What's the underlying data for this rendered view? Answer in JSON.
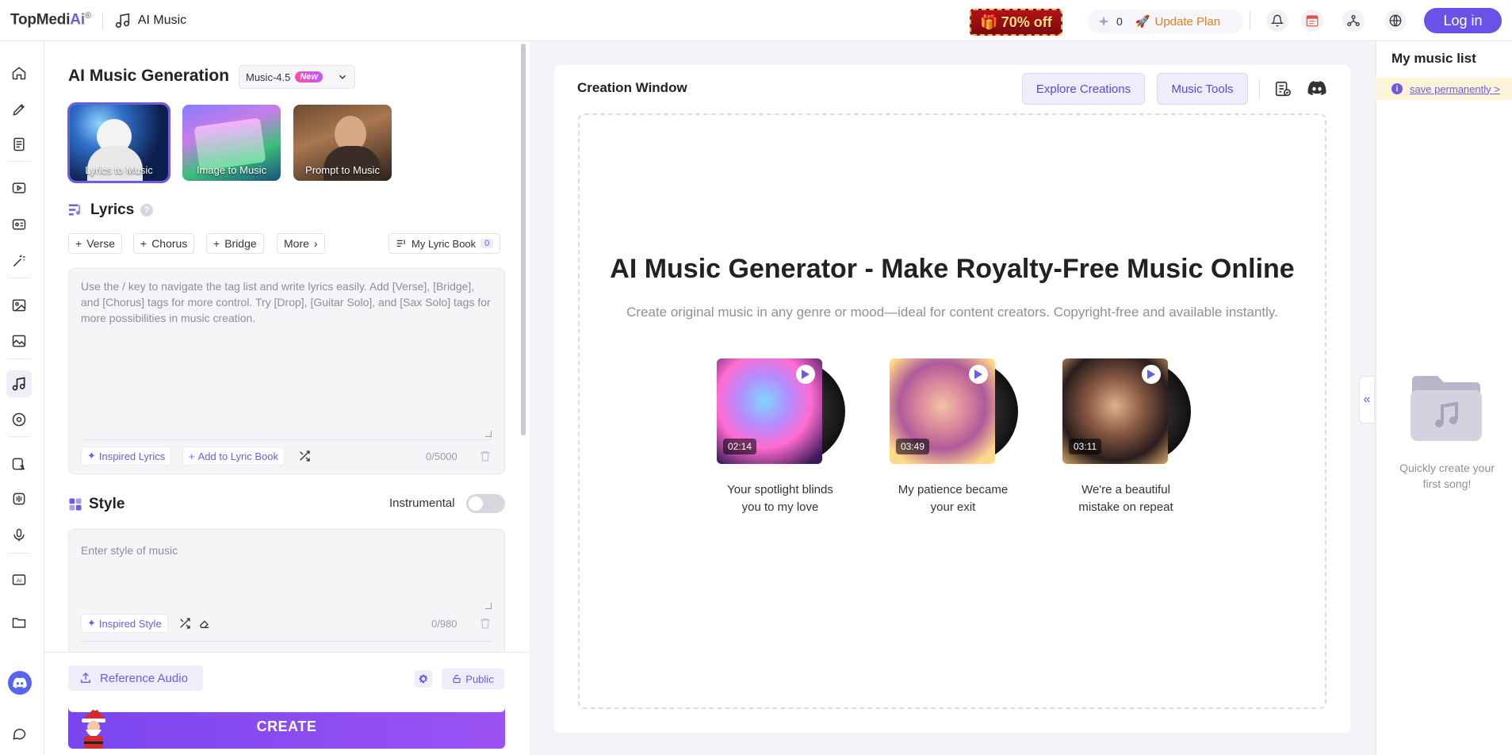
{
  "header": {
    "logo_main": "TopMedi",
    "logo_ai": "Ai",
    "logo_reg": "®",
    "app_name": "AI Music",
    "promo": "70% off",
    "credits": "0",
    "update_plan": "Update Plan",
    "login": "Log in"
  },
  "panel": {
    "title": "AI Music Generation",
    "model": "Music-4.5",
    "model_badge": "New",
    "modes": [
      {
        "label": "Lyrics to Music",
        "active": true
      },
      {
        "label": "Image to Music",
        "active": false
      },
      {
        "label": "Prompt to Music",
        "active": false
      }
    ],
    "lyrics": {
      "title": "Lyrics",
      "chips": [
        "Verse",
        "Chorus",
        "Bridge",
        "More"
      ],
      "lyric_book": "My Lyric Book",
      "lyric_book_count": "0",
      "placeholder": "Use the / key to navigate the tag list and write lyrics easily. Add [Verse], [Bridge], and [Chorus] tags for more control. Try [Drop], [Guitar Solo], and [Sax Solo] tags for more possibilities in music creation.",
      "inspired": "Inspired Lyrics",
      "add_book": "Add to Lyric Book",
      "counter": "0/5000"
    },
    "style": {
      "title": "Style",
      "instrumental": "Instrumental",
      "instrumental_on": false,
      "placeholder": "Enter style of music",
      "inspired": "Inspired Style",
      "counter": "0/980"
    },
    "reference_audio": "Reference Audio",
    "public": "Public",
    "create": "CREATE"
  },
  "creation": {
    "title": "Creation Window",
    "explore": "Explore Creations",
    "tools": "Music Tools",
    "headline": "AI Music Generator - Make Royalty-Free Music Online",
    "subline": "Create original music in any genre or mood—ideal for content creators. Copyright-free and available instantly.",
    "songs": [
      {
        "duration": "02:14",
        "title_l1": "Your spotlight blinds",
        "title_l2": "you to my love"
      },
      {
        "duration": "03:49",
        "title_l1": "My patience became",
        "title_l2": "your exit"
      },
      {
        "duration": "03:11",
        "title_l1": "We're a beautiful",
        "title_l2": "mistake on repeat"
      }
    ]
  },
  "music_list": {
    "title": "My music list",
    "save": "save permanently >",
    "empty_l1": "Quickly create your",
    "empty_l2": "first song!"
  },
  "colors": {
    "accent": "#6a52e8",
    "note_bg": "#fff3d9",
    "update_plan": "#d9822b"
  }
}
